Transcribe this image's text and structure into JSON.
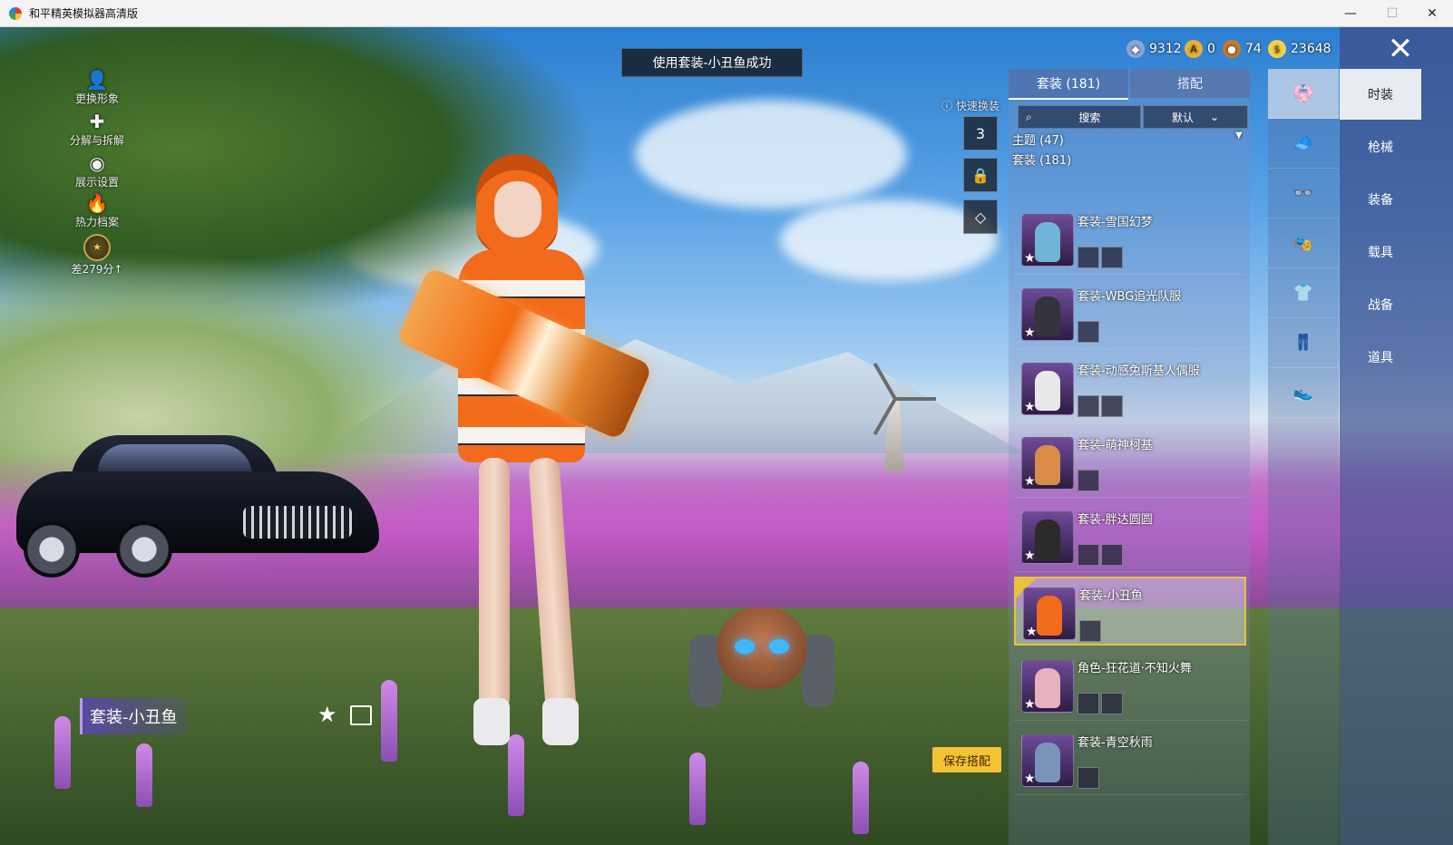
{
  "window": {
    "title": "和平精英模拟器高清版",
    "min": "—",
    "max": "☐",
    "close": "✕"
  },
  "toast": "使用套装-小丑鱼成功",
  "left_menu": [
    {
      "icon": "person-icon",
      "glyph": "👤",
      "label": "更换形象"
    },
    {
      "icon": "puzzle-icon",
      "glyph": "✚",
      "label": "分解与拆解"
    },
    {
      "icon": "eye-icon",
      "glyph": "◉",
      "label": "展示设置"
    },
    {
      "icon": "flame-icon",
      "glyph": "🔥",
      "label": "热力档案"
    }
  ],
  "rank": {
    "label": "差279分↑"
  },
  "currencies": [
    {
      "icon": "uc-icon",
      "value": "9312",
      "color": "#8aa3d6"
    },
    {
      "icon": "coupon-icon",
      "value": "0",
      "color": "#e4b23a"
    },
    {
      "icon": "bronze-icon",
      "value": "74",
      "color": "#c47a2c"
    },
    {
      "icon": "gold-coin-icon",
      "value": "23648",
      "color": "#f1d24a"
    }
  ],
  "quick_change": {
    "label": "快速换装",
    "slot_number": "3"
  },
  "panel": {
    "tabs": {
      "outfits": "套装 (181)",
      "match": "搭配"
    },
    "search_placeholder": "搜索",
    "sort": "默认",
    "categories": {
      "theme": "主题 (47)",
      "outfit": "套装 (181)"
    },
    "items": [
      {
        "name": "套装-雪国幻梦",
        "color": "#6fb5d8"
      },
      {
        "name": "套装-WBG追光队服",
        "color": "#33343c"
      },
      {
        "name": "套装-动感兔斯基人偶服",
        "color": "#e8e8e8"
      },
      {
        "name": "套装-萌神柯基",
        "color": "#d98c48"
      },
      {
        "name": "套装-胖达圆圆",
        "color": "#2b2b2b"
      },
      {
        "name": "套装-小丑鱼",
        "color": "#f26a1b"
      },
      {
        "name": "角色-狂花道·不知火舞",
        "color": "#e7b1c0"
      },
      {
        "name": "套装-青空秋雨",
        "color": "#7a93b8"
      }
    ]
  },
  "side_categories": [
    "outfit-icon",
    "hat-icon",
    "glasses-icon",
    "mask-icon",
    "top-icon",
    "pants-icon",
    "shoes-icon"
  ],
  "side_glyphs": [
    "👘",
    "🧢",
    "👓",
    "🎭",
    "👕",
    "👖",
    "👟"
  ],
  "main_categories": [
    "时装",
    "枪械",
    "装备",
    "载具",
    "战备",
    "道具"
  ],
  "current_outfit": "套装-小丑鱼",
  "save_button": "保存搭配"
}
